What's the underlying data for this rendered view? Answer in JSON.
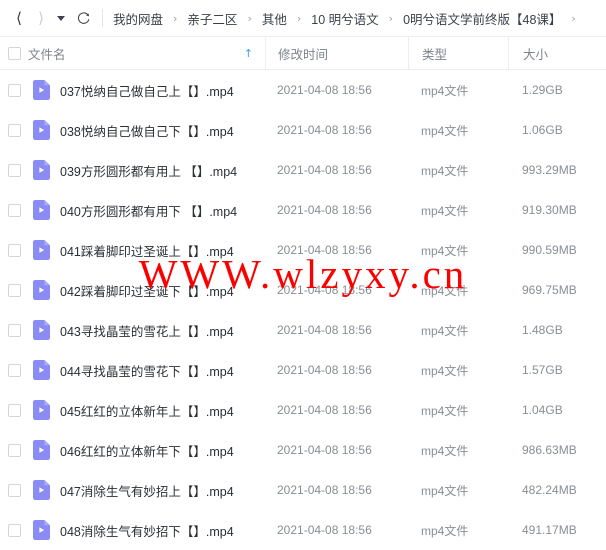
{
  "toolbar": {
    "back_icon": "chevron-left-icon",
    "forward_icon": "chevron-right-icon",
    "dropdown_icon": "caret-down-icon",
    "refresh_icon": "refresh-icon",
    "breadcrumb": {
      "separator": "›",
      "items": [
        "我的网盘",
        "亲子二区",
        "其他",
        "10 明兮语文",
        "0明兮语文学前终版【48课】"
      ]
    }
  },
  "table": {
    "select_all_checkbox": "",
    "columns": {
      "name": "文件名",
      "time": "修改时间",
      "type": "类型",
      "size": "大小"
    },
    "sort": {
      "column": "name",
      "direction": "asc",
      "glyph": "↑",
      "color": "#3aa0f0"
    },
    "file_icon": "video-file-icon",
    "file_icon_color": "#8b8bf5",
    "rows": [
      {
        "name": "037悦纳自己做自己上【】.mp4",
        "time": "2021-04-08 18:56",
        "type": "mp4文件",
        "size": "1.29GB"
      },
      {
        "name": "038悦纳自己做自己下【】.mp4",
        "time": "2021-04-08 18:56",
        "type": "mp4文件",
        "size": "1.06GB"
      },
      {
        "name": "039方形圆形都有用上 【】.mp4",
        "time": "2021-04-08 18:56",
        "type": "mp4文件",
        "size": "993.29MB"
      },
      {
        "name": "040方形圆形都有用下 【】.mp4",
        "time": "2021-04-08 18:56",
        "type": "mp4文件",
        "size": "919.30MB"
      },
      {
        "name": "041踩着脚印过圣诞上【】.mp4",
        "time": "2021-04-08 18:56",
        "type": "mp4文件",
        "size": "990.59MB"
      },
      {
        "name": "042踩着脚印过圣诞下【】.mp4",
        "time": "2021-04-08 18:56",
        "type": "mp4文件",
        "size": "969.75MB"
      },
      {
        "name": "043寻找晶莹的雪花上【】.mp4",
        "time": "2021-04-08 18:56",
        "type": "mp4文件",
        "size": "1.48GB"
      },
      {
        "name": "044寻找晶莹的雪花下【】.mp4",
        "time": "2021-04-08 18:56",
        "type": "mp4文件",
        "size": "1.57GB"
      },
      {
        "name": "045红红的立体新年上【】.mp4",
        "time": "2021-04-08 18:56",
        "type": "mp4文件",
        "size": "1.04GB"
      },
      {
        "name": "046红红的立体新年下【】.mp4",
        "time": "2021-04-08 18:56",
        "type": "mp4文件",
        "size": "986.63MB"
      },
      {
        "name": "047消除生气有妙招上【】.mp4",
        "time": "2021-04-08 18:56",
        "type": "mp4文件",
        "size": "482.24MB"
      },
      {
        "name": "048消除生气有妙招下【】.mp4",
        "time": "2021-04-08 18:56",
        "type": "mp4文件",
        "size": "491.17MB"
      }
    ]
  },
  "watermark": {
    "text": "WWW.wlzyxy.cn",
    "color": "#fc0000"
  }
}
